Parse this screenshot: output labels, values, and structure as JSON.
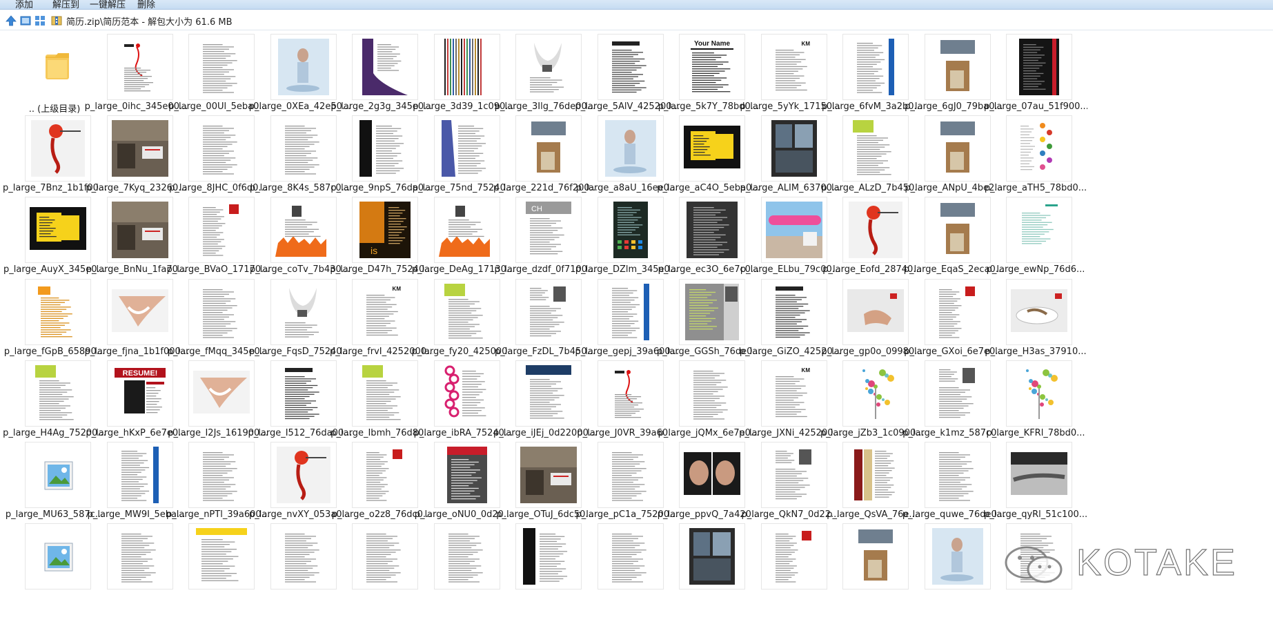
{
  "toolbar": {
    "buttons": [
      "添加",
      "解压到",
      "一键解压",
      "删除"
    ]
  },
  "address": {
    "path": "简历.zip\\简历范本 - 解包大小为 61.6 MB"
  },
  "icons": {
    "up": "up-arrow-icon",
    "view1": "thumbnail-view-icon",
    "view2": "grid-view-icon",
    "zip": "zip-archive-icon"
  },
  "files": [
    [
      ".. (上级目录)",
      "p_large_0ihc_345e00...",
      "p_large_00Ul_5eba0...",
      "p_large_0XEa_42e50...",
      "p_large_2g3g_345e0...",
      "p_large_3d39_1c090...",
      "p_large_3Ilg_76de00...",
      "p_large_5AlV_425200...",
      "p_large_5k7Y_78bd0...",
      "p_large_5yYk_17150...",
      "p_large_6fvM_3a2b0...",
      "p_large_6gJ0_79ba0...",
      "p_large_07au_51f900..."
    ],
    [
      "p_large_7Bnz_1b1f00...",
      "p_large_7Kyq_23260...",
      "p_large_8JHC_0f6d0...",
      "p_large_8K4s_587c0...",
      "p_large_9npS_76da0...",
      "p_large_75nd_75240...",
      "p_large_221d_76f200...",
      "p_large_a8aU_16ee0...",
      "p_large_aC4O_5eba0...",
      "p_large_ALIM_63700...",
      "p_large_ALzD_7b450...",
      "p_large_ANpU_4be2...",
      "p_large_aTH5_78bd0..."
    ],
    [
      "p_large_AuyX_345e0...",
      "p_large_BnNu_1fa70...",
      "p_large_BVaO_17170...",
      "p_large_coTv_7b430...",
      "p_large_D47h_75240...",
      "p_large_DeAg_17130...",
      "p_large_dzdf_0f7100...",
      "p_large_DZlm_345e0...",
      "p_large_ec3O_6e7c0...",
      "p_large_ELbu_79c00...",
      "p_large_Eofd_28740...",
      "p_large_EqaS_2eca0...",
      "p_large_ewNp_76d6..."
    ],
    [
      "p_large_fGpB_65890...",
      "p_large_fjna_1b1f000...",
      "p_large_fMqq_345e0...",
      "p_large_FqsD_75240...",
      "p_large_frvI_4252000...",
      "p_large_fy20_425000...",
      "p_large_FzDL_7b450...",
      "p_large_gepj_39a600...",
      "p_large_GGSh_76de0...",
      "p_large_GiZO_42520...",
      "p_large_gp0o_09980...",
      "p_large_GXoi_6e7e0...",
      "p_large_H3as_37910..."
    ],
    [
      "p_large_H4Ag_75200...",
      "p_large_hKxP_6e7e0...",
      "p_large_I2Js_161900...",
      "p_large_I512_76da00...",
      "p_large_Ibmh_76d80...",
      "p_large_ibRA_75240...",
      "p_large_iJEj_0d22000...",
      "p_large_J0VR_39a60...",
      "p_large_jQMx_6e7e0...",
      "p_large_JXNi_425200...",
      "p_large_jZb3_1c0900...",
      "p_large_k1mz_587c0...",
      "p_large_KFRl_78bd0..."
    ],
    [
      "p_large_MU63_587c...",
      "p_large_MW9I_5eba...",
      "p_large_nPTl_39a600...",
      "p_large_nvXY_053a0...",
      "p_large_o2z8_76dc0...",
      "p_large_oNU0_0d20...",
      "p_large_OTuJ_6dc50...",
      "p_large_pC1a_75200...",
      "p_large_ppvQ_7a420...",
      "p_large_QkN7_0d22...",
      "p_large_QsVA_76e...",
      "p_large_quwe_76de0...",
      "p_large_qyRl_51c100..."
    ],
    [
      "",
      "",
      "",
      "",
      "",
      "",
      "",
      "",
      "",
      "",
      "",
      "",
      ""
    ]
  ],
  "thumb_kinds": [
    [
      "folder",
      "resume-red",
      "doc",
      "photo-blue",
      "purple",
      "stripes",
      "ghost",
      "doc-bold",
      "yourname",
      "doc-km",
      "doc-blue",
      "photo-mixed",
      "dark-red"
    ],
    [
      "red-figure",
      "photo-street",
      "doc",
      "doc",
      "dark-side",
      "purple-side",
      "photo-mixed",
      "photo-blue",
      "yellow-black",
      "photo-dark",
      "doc-green",
      "photo-mixed",
      "colorful"
    ],
    [
      "yellow-black",
      "photo-street",
      "doc-red",
      "orange-bottom",
      "dark-orange",
      "orange-bottom",
      "doc-gray",
      "dark-green",
      "dark-doc",
      "pink-photo",
      "red-figure",
      "photo-mixed",
      "doc-teal"
    ],
    [
      "doc-orange",
      "photo-skin",
      "doc",
      "ghost",
      "doc-km",
      "doc-green",
      "doc-photo",
      "doc-blue",
      "gray-green",
      "doc-bold",
      "photo-hand",
      "doc-red",
      "photo-plate"
    ],
    [
      "doc-green",
      "resume-poster",
      "photo-skin",
      "doc-bold",
      "doc-green",
      "pink-circles",
      "doc-navy",
      "resume-red",
      "doc",
      "doc-km",
      "splash",
      "doc-photo",
      "splash"
    ],
    [
      "image-icon",
      "doc-blue",
      "doc",
      "red-figure",
      "doc-red",
      "dark-red-doc",
      "photo-street",
      "doc",
      "photo-faces",
      "doc-photo",
      "doc-mixed",
      "doc",
      "photo-gray"
    ],
    [
      "image-icon",
      "doc",
      "yellow-top",
      "doc",
      "doc",
      "doc",
      "dark-side",
      "doc",
      "photo-dark",
      "doc-red",
      "photo-mixed",
      "photo-blue",
      "doc"
    ]
  ],
  "watermark": {
    "text": "KOTAKE",
    "icon": "wechat-icon"
  }
}
